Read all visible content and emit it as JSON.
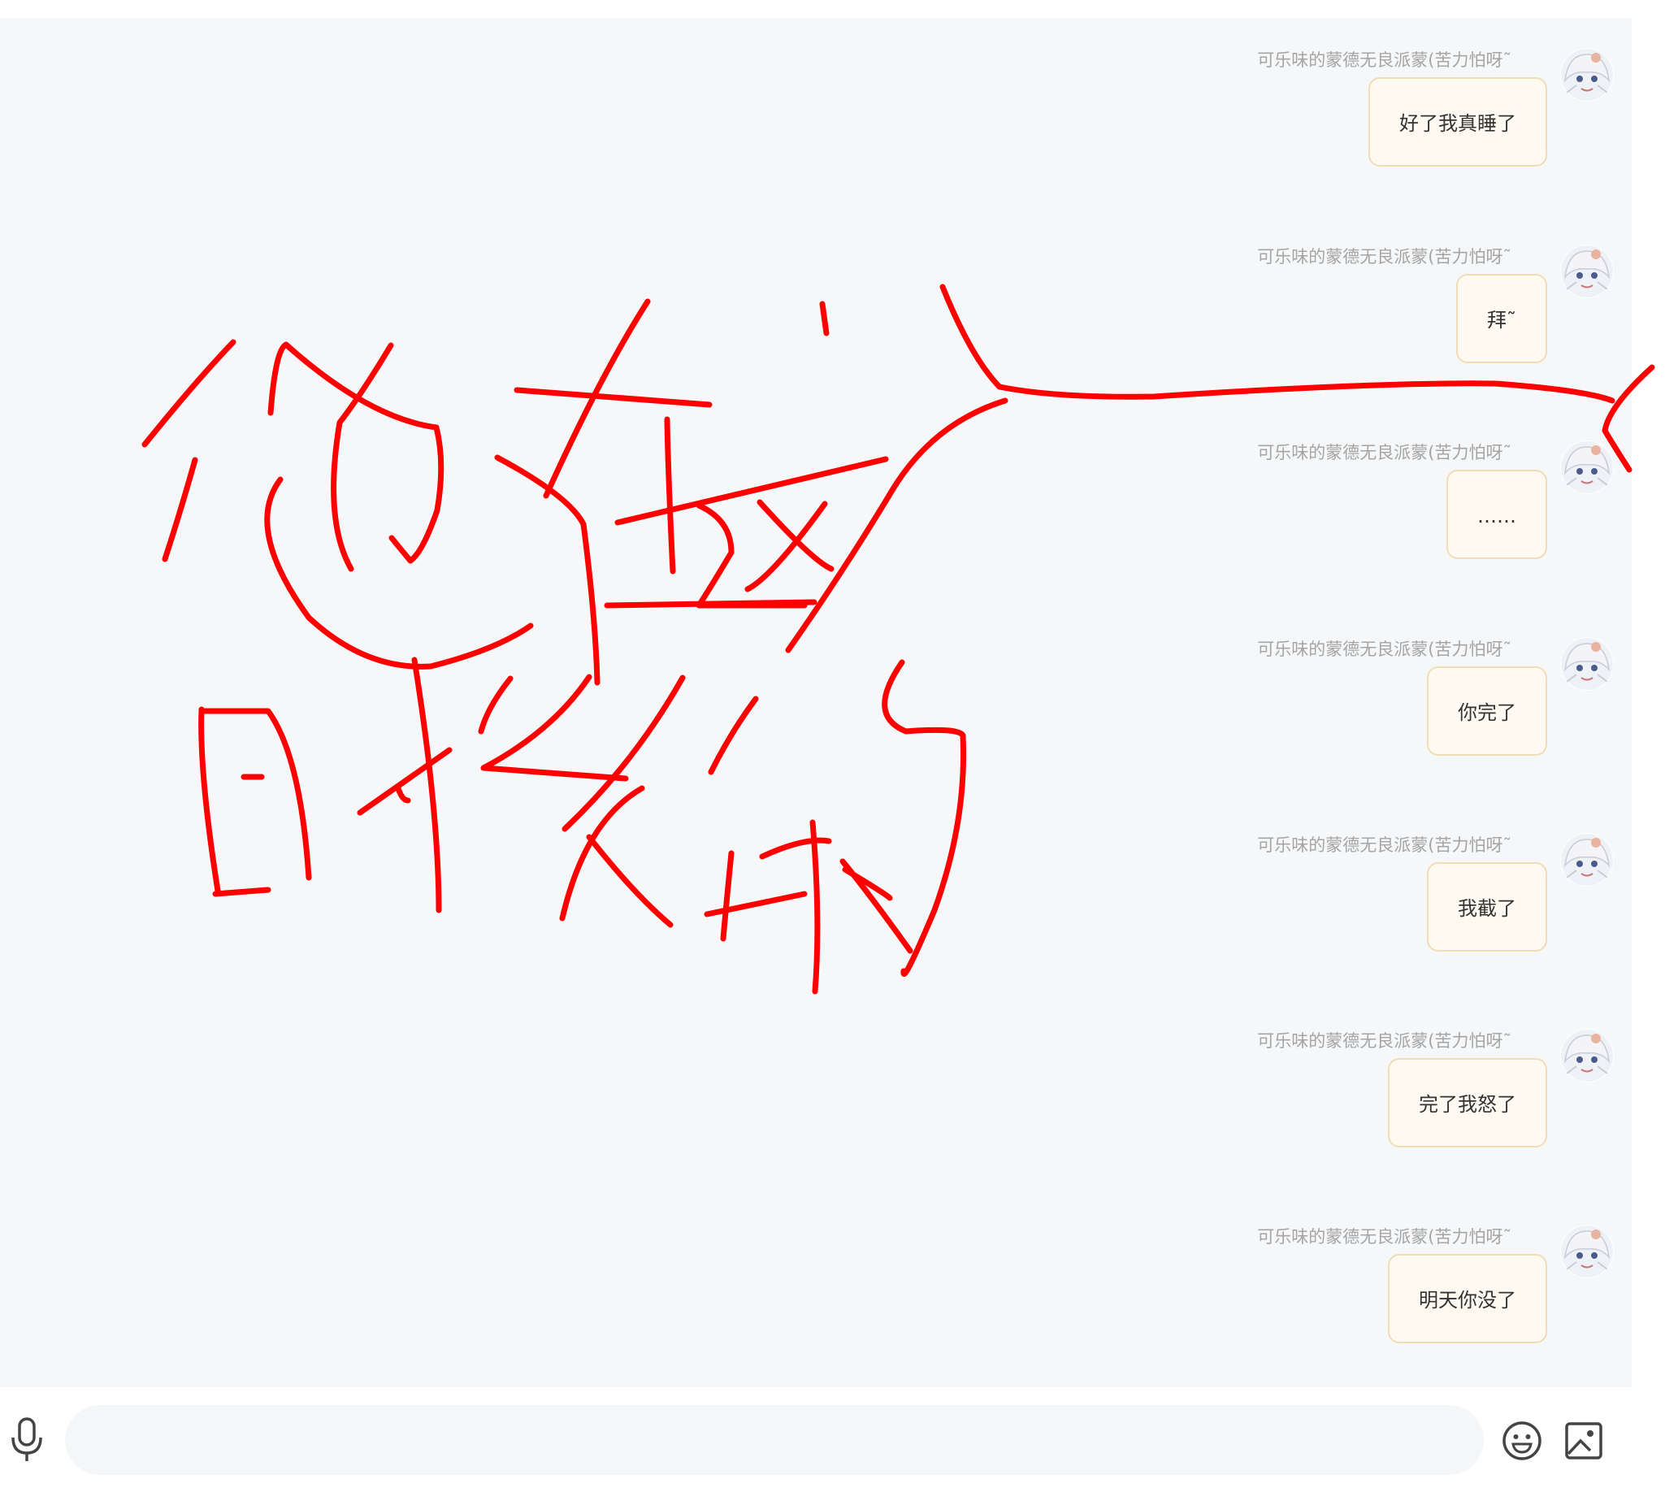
{
  "chat": {
    "messages": [
      {
        "sender": "可乐味的蒙德无良派蒙(苦力怕呀˜",
        "text": "好了我真睡了"
      },
      {
        "sender": "可乐味的蒙德无良派蒙(苦力怕呀˜",
        "text": "拜˜"
      },
      {
        "sender": "可乐味的蒙德无良派蒙(苦力怕呀˜",
        "text": "……"
      },
      {
        "sender": "可乐味的蒙德无良派蒙(苦力怕呀˜",
        "text": "你完了"
      },
      {
        "sender": "可乐味的蒙德无良派蒙(苦力怕呀˜",
        "text": "我截了"
      },
      {
        "sender": "可乐味的蒙德无良派蒙(苦力怕呀˜",
        "text": "完了我怒了"
      },
      {
        "sender": "可乐味的蒙德无良派蒙(苦力怕呀˜",
        "text": "明天你没了"
      }
    ]
  },
  "input_bar": {
    "placeholder": "",
    "icons": [
      "microphone-icon",
      "emoji-icon",
      "image-icon"
    ]
  },
  "annotation": {
    "handwritten_text": "他在这发的时候",
    "color": "#ff0000"
  },
  "colors": {
    "chat_background": "#f5f7f9",
    "bubble_background": "#fffaf1",
    "bubble_border": "#f0ddb5",
    "sender_text": "#a5a5a5",
    "annotation": "#ff0000"
  }
}
